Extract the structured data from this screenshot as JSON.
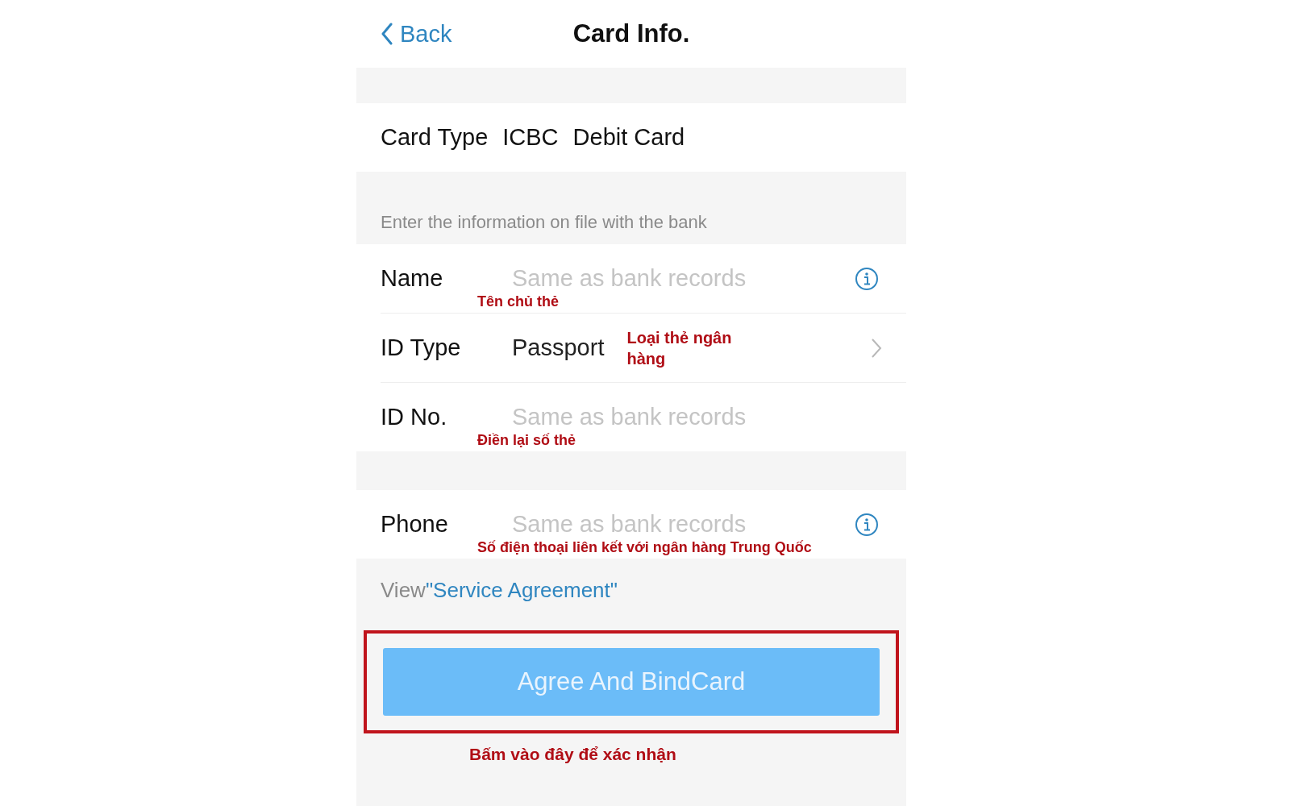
{
  "nav": {
    "back": "Back",
    "title": "Card Info."
  },
  "card_type": {
    "label": "Card Type",
    "bank": "ICBC",
    "type": "Debit Card"
  },
  "hint": "Enter the information on file with the bank",
  "groups": [
    [
      {
        "kind": "input",
        "label": "Name",
        "placeholder": "Same as bank records",
        "info": true,
        "note": "Tên chủ thẻ"
      },
      {
        "kind": "select",
        "label": "ID Type",
        "value": "Passport",
        "note": "Loại thẻ ngân hàng"
      },
      {
        "kind": "input",
        "label": "ID No.",
        "placeholder": "Same as bank records",
        "info": false,
        "note": "Điền lại số thẻ"
      }
    ],
    [
      {
        "kind": "input",
        "label": "Phone",
        "placeholder": "Same as bank records",
        "info": true,
        "note": "Số điện thoại liên kết với ngân hàng Trung Quốc"
      }
    ]
  ],
  "agreement": {
    "prefix": "View",
    "link": "\"Service Agreement\""
  },
  "button": {
    "label": "Agree And BindCard",
    "highlighted": true,
    "note": "Bấm vào đây để xác nhận"
  }
}
